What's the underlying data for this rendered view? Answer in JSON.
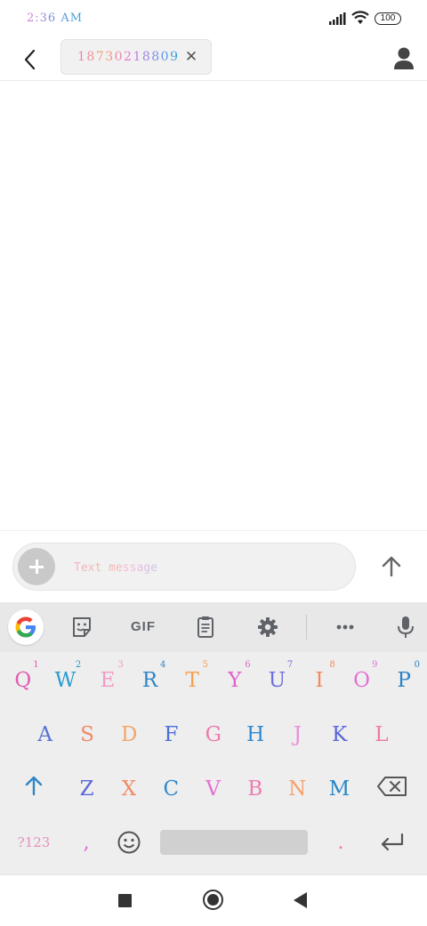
{
  "status_bar": {
    "time": "2:36 AM",
    "battery": "100",
    "icons": [
      "signal-icon",
      "wifi-icon",
      "battery-icon"
    ]
  },
  "header": {
    "recipient": "18730218809",
    "icons": [
      "back-arrow-icon",
      "close-icon",
      "contact-icon"
    ]
  },
  "composer": {
    "placeholder": "Text message",
    "icons": [
      "plus-icon",
      "send-arrow-icon"
    ]
  },
  "keyboard": {
    "toolbar": {
      "gif_label": "GIF",
      "icons": [
        "google-g-icon",
        "sticker-icon",
        "clipboard-icon",
        "settings-gear-icon",
        "more-dots-icon",
        "microphone-icon"
      ]
    },
    "row1": [
      {
        "label": "Q",
        "hint": "1",
        "color": "#e05bb0"
      },
      {
        "label": "W",
        "hint": "2",
        "color": "#2a9bd0"
      },
      {
        "label": "E",
        "hint": "3",
        "color": "#f29ac8"
      },
      {
        "label": "R",
        "hint": "4",
        "color": "#2e86c8"
      },
      {
        "label": "T",
        "hint": "5",
        "color": "#f3a04f"
      },
      {
        "label": "Y",
        "hint": "6",
        "color": "#e25fd0"
      },
      {
        "label": "U",
        "hint": "7",
        "color": "#6f6de0"
      },
      {
        "label": "I",
        "hint": "8",
        "color": "#f38a5a"
      },
      {
        "label": "O",
        "hint": "9",
        "color": "#e56fd8"
      },
      {
        "label": "P",
        "hint": "0",
        "color": "#2a83c6"
      }
    ],
    "row2": [
      {
        "label": "A",
        "color": "#5572d6"
      },
      {
        "label": "S",
        "color": "#f08a68"
      },
      {
        "label": "D",
        "color": "#f4a66b"
      },
      {
        "label": "F",
        "color": "#4b6fd8"
      },
      {
        "label": "G",
        "color": "#f07ab0"
      },
      {
        "label": "H",
        "color": "#2e8ad0"
      },
      {
        "label": "J",
        "color": "#e98fd8"
      },
      {
        "label": "K",
        "color": "#5a67d8"
      },
      {
        "label": "L",
        "color": "#f17aa0"
      }
    ],
    "row3": [
      {
        "label": "Z",
        "color": "#5a67d8"
      },
      {
        "label": "X",
        "color": "#f08a68"
      },
      {
        "label": "C",
        "color": "#2e8ad0"
      },
      {
        "label": "V",
        "color": "#e56fd0"
      },
      {
        "label": "B",
        "color": "#f07ab0"
      },
      {
        "label": "N",
        "color": "#f4a06b"
      },
      {
        "label": "M",
        "color": "#2a86c6"
      }
    ],
    "symbols_label": "?123",
    "comma": ",",
    "period": ".",
    "icons": [
      "shift-arrow-icon",
      "backspace-icon",
      "emoji-icon",
      "enter-icon"
    ]
  },
  "navigation": {
    "icons": [
      "recents-square-icon",
      "home-circle-icon",
      "back-triangle-icon"
    ]
  },
  "colors": {
    "accent": "#2e86c8",
    "keyboard_bg": "#eeeeee",
    "chip_bg": "#f1f1f1"
  }
}
